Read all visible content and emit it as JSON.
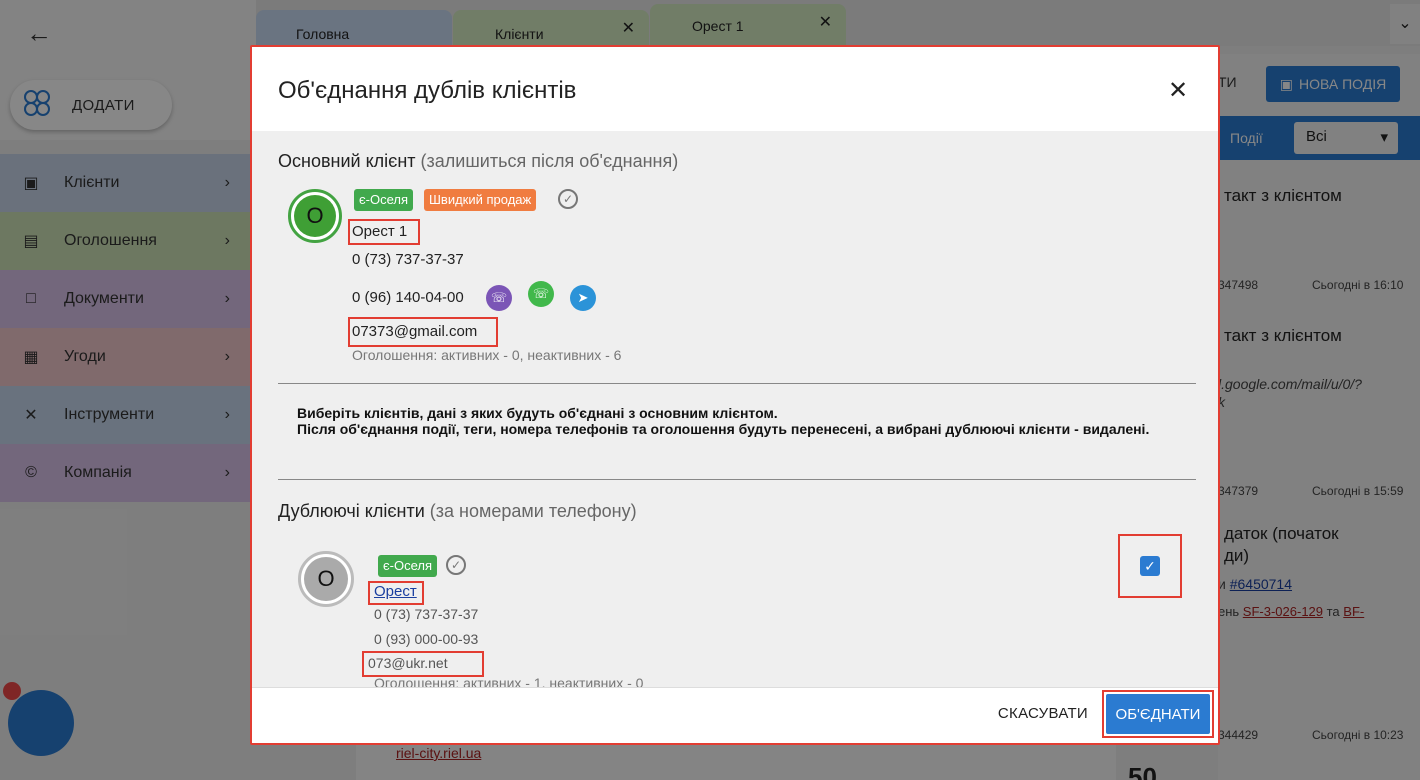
{
  "app": {
    "back_icon": "arrow-left-icon",
    "add_button_label": "ДОДАТИ",
    "sidebar": [
      {
        "label": "Клієнти",
        "icon": "contacts-icon",
        "color": "#c9d6ea"
      },
      {
        "label": "Оголошення",
        "icon": "listing-icon",
        "color": "#cfe3b8"
      },
      {
        "label": "Документи",
        "icon": "folder-icon",
        "color": "#d9c3ea"
      },
      {
        "label": "Угоди",
        "icon": "money-icon",
        "color": "#f2c8cc"
      },
      {
        "label": "Інструменти",
        "icon": "tools-icon",
        "color": "#c6d8ee"
      },
      {
        "label": "Компанія",
        "icon": "copyright-icon",
        "color": "#d9c3ea"
      }
    ],
    "tabs": [
      {
        "label": "Головна"
      },
      {
        "label": "Клієнти"
      },
      {
        "label": "Орест 1"
      }
    ],
    "right_panel": {
      "button_partial": "ТИ",
      "new_event_button": "НОВА ПОДІЯ",
      "filter_label": "Події",
      "filter_value": "Всі",
      "items": [
        {
          "title": "такт з клієнтом",
          "meta_id": "347498",
          "meta_time": "Сьогодні в 16:10"
        },
        {
          "title": "такт з клієнтом",
          "snippet": "l.google.com/mail/u/0/?",
          "snippet2": "k",
          "meta_id": "347379",
          "meta_time": "Сьогодні в 15:59"
        },
        {
          "title": "даток (початок",
          "title2": "ди)",
          "link_prefix": "и ",
          "link": "#6450714",
          "line3_prefix": "ень ",
          "line3_link1": "SF-3-026-129",
          "line3_mid": " та ",
          "line3_link2": "BF-",
          "meta_id": "344429",
          "meta_time": "Сьогодні в 10:23"
        }
      ]
    },
    "bottom_link": "riel-city.riel.ua",
    "bottom_big_text": "50"
  },
  "modal": {
    "title": "Об'єднання дублів клієнтів",
    "close_icon": "close-icon",
    "main_client": {
      "section_title": "Основний клієнт",
      "section_note": "(залишиться після об'єднання)",
      "avatar_letter": "О",
      "tags": [
        "є-Оселя",
        "Швидкий продаж"
      ],
      "name": "Орест 1",
      "phone1": "0 (73) 737-37-37",
      "phone2": "0 (96) 140-04-00",
      "email": "07373@gmail.com",
      "listings": "Оголошення: активних - 0, неактивних - 6"
    },
    "notice": "Виберіть клієнтів, дані з яких будуть об'єднані з основним клієнтом.\nПісля об'єднання події, теги, номера телефонів та оголошення будуть перенесені, а вибрані дублюючі клієнти - видалені.",
    "duplicates": {
      "section_title": "Дублюючі клієнти",
      "section_note": "(за номерами телефону)",
      "items": [
        {
          "avatar_letter": "О",
          "tag": "є-Оселя",
          "name": "Орест",
          "phone1": "0 (73) 737-37-37",
          "phone2": "0 (93) 000-00-93",
          "email": "073@ukr.net",
          "listings": "Оголошення: активних - 1, неактивних - 0",
          "selected": true
        }
      ]
    },
    "cancel_label": "СКАСУВАТИ",
    "merge_label": "ОБ'ЄДНАТИ",
    "colors": {
      "accent": "#2b7bd1",
      "highlight_border": "#e23d32",
      "tag_green": "#41a94d",
      "tag_orange": "#f07c40"
    }
  }
}
